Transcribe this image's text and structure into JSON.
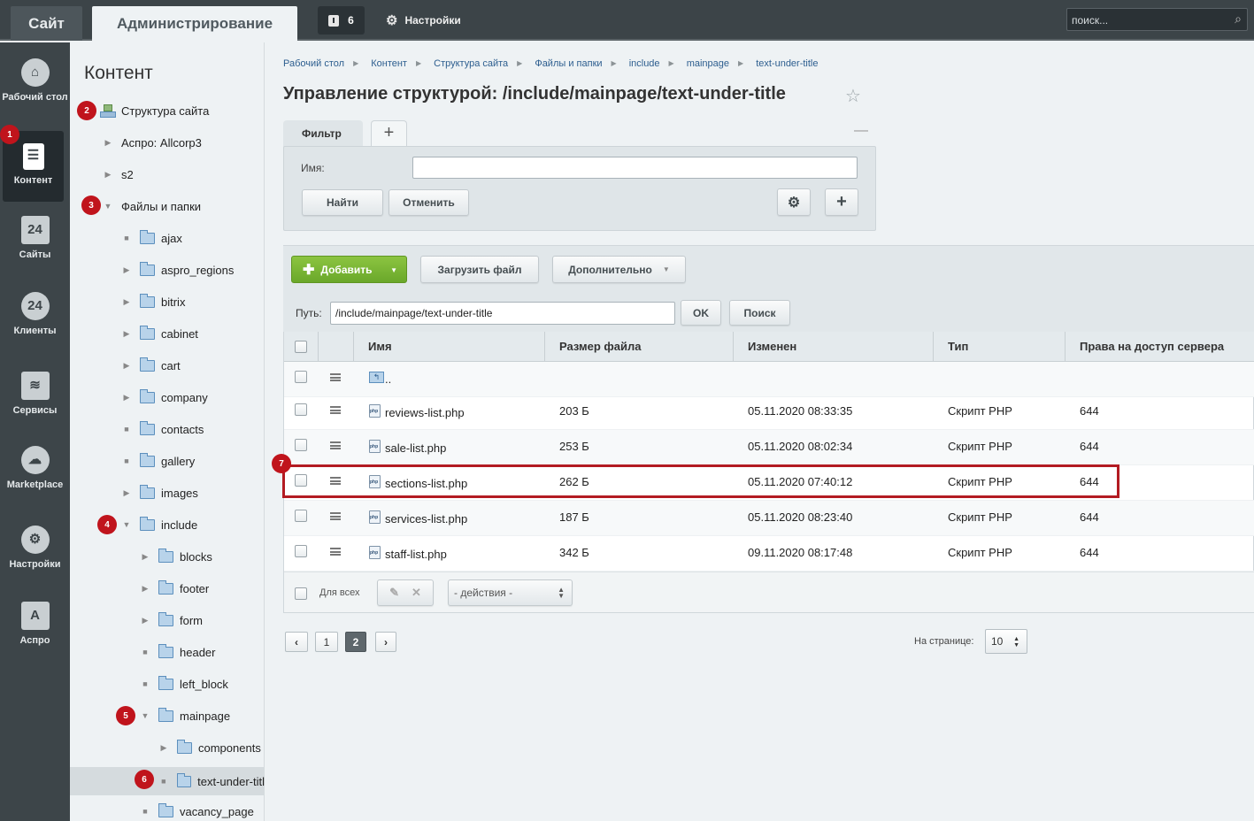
{
  "topbar": {
    "site_tab": "Сайт",
    "admin_tab": "Администрирование",
    "notifications_count": "6",
    "settings_label": "Настройки",
    "search_placeholder": "поиск..."
  },
  "iconbar": {
    "items": [
      {
        "label": "Рабочий стол",
        "icon": "home-icon"
      },
      {
        "label": "Контент",
        "icon": "content-icon"
      },
      {
        "label": "Сайты",
        "icon": "calendar-icon",
        "glyph": "24"
      },
      {
        "label": "Клиенты",
        "icon": "clients-icon",
        "glyph": "24"
      },
      {
        "label": "Сервисы",
        "icon": "layers-icon"
      },
      {
        "label": "Marketplace",
        "icon": "cloud-icon"
      },
      {
        "label": "Настройки",
        "icon": "gear-icon"
      },
      {
        "label": "Аспро",
        "icon": "aspro-icon",
        "glyph": "A"
      }
    ]
  },
  "tree": {
    "title": "Контент",
    "nodes": [
      {
        "label": "Структура сайта"
      },
      {
        "label": "Аспро: Allcorp3"
      },
      {
        "label": "s2"
      },
      {
        "label": "Файлы и папки"
      },
      {
        "label": "ajax"
      },
      {
        "label": "aspro_regions"
      },
      {
        "label": "bitrix"
      },
      {
        "label": "cabinet"
      },
      {
        "label": "cart"
      },
      {
        "label": "company"
      },
      {
        "label": "contacts"
      },
      {
        "label": "gallery"
      },
      {
        "label": "images"
      },
      {
        "label": "include"
      },
      {
        "label": "blocks"
      },
      {
        "label": "footer"
      },
      {
        "label": "form"
      },
      {
        "label": "header"
      },
      {
        "label": "left_block"
      },
      {
        "label": "mainpage"
      },
      {
        "label": "components"
      },
      {
        "label": "text-under-titl"
      },
      {
        "label": "vacancy_page"
      }
    ]
  },
  "badges": [
    "1",
    "2",
    "3",
    "4",
    "5",
    "6",
    "7"
  ],
  "breadcrumb": [
    "Рабочий стол",
    "Контент",
    "Структура сайта",
    "Файлы и папки",
    "include",
    "mainpage",
    "text-under-title"
  ],
  "page_title": "Управление структурой: /include/mainpage/text-under-title",
  "filter": {
    "tab_label": "Фильтр",
    "add_tab": "+",
    "name_label": "Имя:",
    "name_value": "",
    "find_button": "Найти",
    "cancel_button": "Отменить"
  },
  "toolbar": {
    "add_button": "Добавить",
    "upload_button": "Загрузить файл",
    "more_button": "Дополнительно"
  },
  "pathbar": {
    "label": "Путь:",
    "value": "/include/mainpage/text-under-title",
    "ok_button": "OK",
    "search_button": "Поиск"
  },
  "table": {
    "columns": [
      "Имя",
      "Размер файла",
      "Изменен",
      "Тип",
      "Права на доступ сервера"
    ],
    "up_label": "..",
    "rows": [
      {
        "name": "reviews-list.php",
        "size": "203 Б",
        "modified": "05.11.2020 08:33:35",
        "type": "Скрипт PHP",
        "perm": "644"
      },
      {
        "name": "sale-list.php",
        "size": "253 Б",
        "modified": "05.11.2020 08:02:34",
        "type": "Скрипт PHP",
        "perm": "644"
      },
      {
        "name": "sections-list.php",
        "size": "262 Б",
        "modified": "05.11.2020 07:40:12",
        "type": "Скрипт PHP",
        "perm": "644"
      },
      {
        "name": "services-list.php",
        "size": "187 Б",
        "modified": "05.11.2020 08:23:40",
        "type": "Скрипт PHP",
        "perm": "644"
      },
      {
        "name": "staff-list.php",
        "size": "342 Б",
        "modified": "09.11.2020 08:17:48",
        "type": "Скрипт PHP",
        "perm": "644"
      }
    ],
    "for_all_label": "Для всех",
    "actions_select": "- действия -"
  },
  "pager": {
    "pages": [
      "1",
      "2"
    ],
    "current": "2",
    "per_page_label": "На странице:",
    "per_page_value": "10"
  },
  "colors": {
    "accent_green": "#6aa82a",
    "highlight_red": "#b31b22",
    "badge_red": "#c0141c",
    "topbar": "#3c4448"
  }
}
